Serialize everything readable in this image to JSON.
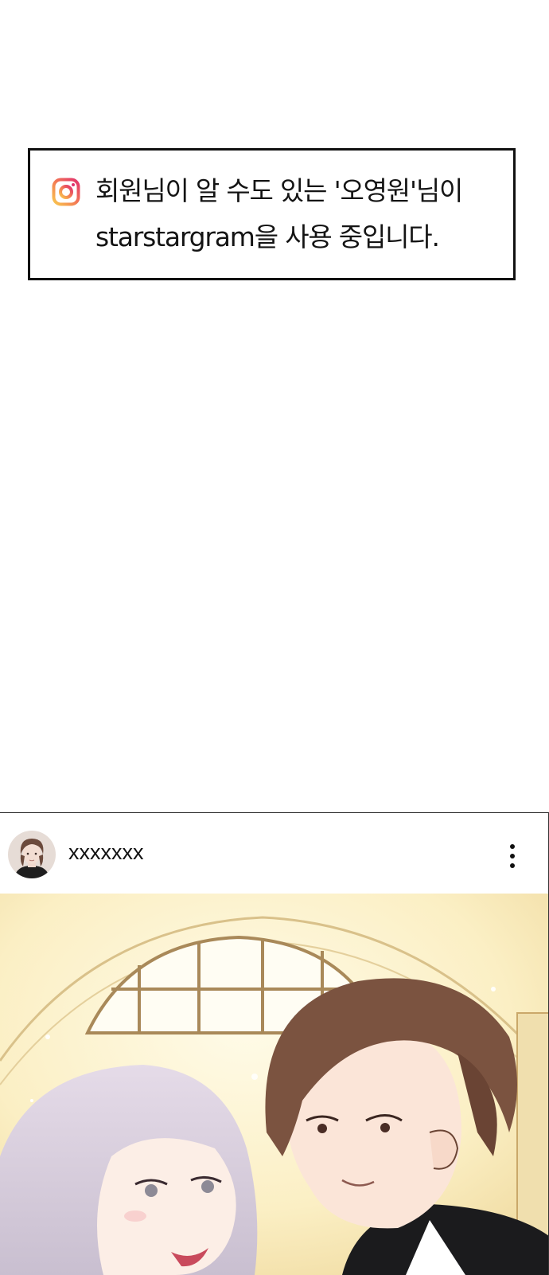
{
  "notice": {
    "icon": "instagram-icon",
    "line1": "회원님이 알 수도 있는 '오영원'님이",
    "line2": "starstargram을 사용 중입니다."
  },
  "post": {
    "username": "xxxxxxx",
    "more_icon": "more-vertical-icon"
  },
  "colors": {
    "icon_gradient_start": "#f5c33b",
    "icon_gradient_end": "#e1306c",
    "border": "#111111"
  }
}
